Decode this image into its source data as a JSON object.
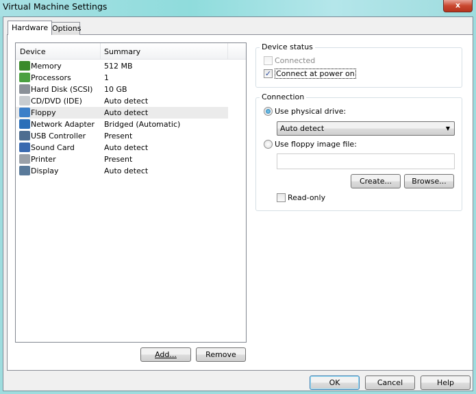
{
  "window": {
    "title": "Virtual Machine Settings",
    "close": "x"
  },
  "tabs": [
    "Hardware",
    "Options"
  ],
  "list": {
    "headers": [
      "Device",
      "Summary"
    ],
    "rows": [
      {
        "name": "Memory",
        "summary": "512 MB",
        "color": "#3a8a2a"
      },
      {
        "name": "Processors",
        "summary": "1",
        "color": "#4aa040"
      },
      {
        "name": "Hard Disk (SCSI)",
        "summary": "10 GB",
        "color": "#8a9098"
      },
      {
        "name": "CD/DVD (IDE)",
        "summary": "Auto detect",
        "color": "#c8ccd0"
      },
      {
        "name": "Floppy",
        "summary": "Auto detect",
        "color": "#3c7fc8"
      },
      {
        "name": "Network Adapter",
        "summary": "Bridged (Automatic)",
        "color": "#2a6eb8"
      },
      {
        "name": "USB Controller",
        "summary": "Present",
        "color": "#4d6d90"
      },
      {
        "name": "Sound Card",
        "summary": "Auto detect",
        "color": "#3a6ab0"
      },
      {
        "name": "Printer",
        "summary": "Present",
        "color": "#9aa0a8"
      },
      {
        "name": "Display",
        "summary": "Auto detect",
        "color": "#5a7a9a"
      }
    ],
    "selected": "Floppy"
  },
  "buttons": {
    "add": "Add...",
    "remove": "Remove",
    "ok": "OK",
    "cancel": "Cancel",
    "help": "Help",
    "create": "Create...",
    "browse": "Browse..."
  },
  "device_status": {
    "label": "Device status",
    "connected": "Connected",
    "connect_power": "Connect at power on"
  },
  "connection": {
    "label": "Connection",
    "physical": "Use physical drive:",
    "drive_value": "Auto detect",
    "image": "Use floppy image file:",
    "image_value": "",
    "read_only": "Read-only"
  }
}
